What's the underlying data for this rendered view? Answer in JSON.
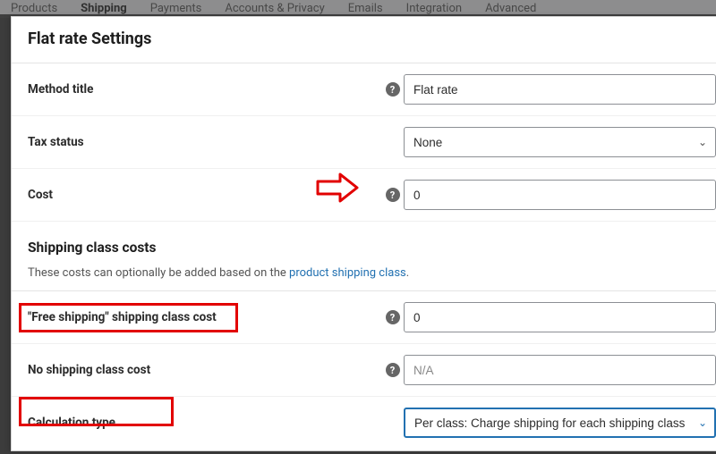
{
  "nav": {
    "products": "Products",
    "shipping": "Shipping",
    "payments": "Payments",
    "accounts": "Accounts & Privacy",
    "emails": "Emails",
    "integration": "Integration",
    "advanced": "Advanced"
  },
  "title": "Flat rate Settings",
  "rows": {
    "method_title": {
      "label": "Method title",
      "value": "Flat rate"
    },
    "tax_status": {
      "label": "Tax status",
      "value": "None"
    },
    "cost": {
      "label": "Cost",
      "value": "0"
    }
  },
  "section": {
    "heading": "Shipping class costs",
    "desc_pre": "These costs can optionally be added based on the ",
    "desc_link": "product shipping class",
    "desc_post": "."
  },
  "class_rows": {
    "free_shipping": {
      "label": "\"Free shipping\" shipping class cost",
      "value": "0"
    },
    "no_class": {
      "label": "No shipping class cost",
      "placeholder": "N/A"
    },
    "calc_type": {
      "label": "Calculation type",
      "value": "Per class: Charge shipping for each shipping class individually"
    }
  }
}
